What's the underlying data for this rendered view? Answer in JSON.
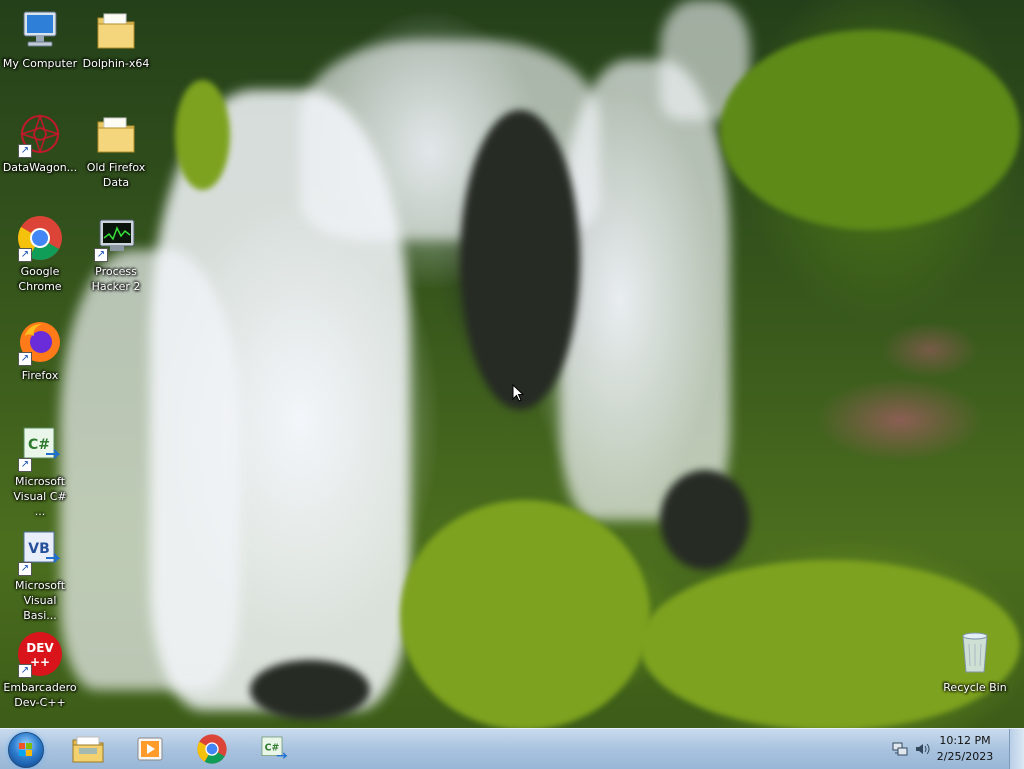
{
  "desktop": {
    "icons": [
      {
        "label": "My Computer",
        "icon": "computer-icon"
      },
      {
        "label": "Dolphin-x64",
        "icon": "folder-icon"
      },
      {
        "label": "DataWagon...",
        "icon": "datawagon-icon"
      },
      {
        "label": "Old Firefox Data",
        "icon": "folder-icon"
      },
      {
        "label": "Google Chrome",
        "icon": "chrome-icon"
      },
      {
        "label": "Process Hacker 2",
        "icon": "process-hacker-icon"
      },
      {
        "label": "Firefox",
        "icon": "firefox-icon"
      },
      {
        "label": "Microsoft Visual C# ...",
        "icon": "visual-csharp-icon",
        "glyph_text": "C#"
      },
      {
        "label": "Microsoft Visual Basi...",
        "icon": "visual-basic-icon",
        "glyph_text": "VB"
      },
      {
        "label": "Embarcadero Dev-C++",
        "icon": "devcpp-icon",
        "glyph_text": "DEV\n++"
      },
      {
        "label": "Recycle Bin",
        "icon": "recycle-bin-icon"
      }
    ]
  },
  "taskbar": {
    "start": {
      "icon": "windows-start-icon"
    },
    "pinned": [
      {
        "name": "Windows Explorer",
        "icon": "file-explorer-icon"
      },
      {
        "name": "Windows Media Player",
        "icon": "media-player-icon"
      },
      {
        "name": "Google Chrome",
        "icon": "chrome-icon"
      },
      {
        "name": "Microsoft Visual C#",
        "icon": "visual-csharp-icon",
        "glyph_text": "C#"
      }
    ],
    "tray": {
      "network_icon": "network-icon",
      "volume_icon": "volume-icon",
      "time": "10:12 PM",
      "date": "2/25/2023"
    }
  },
  "colors": {
    "taskbar": "#a9c3df",
    "chrome_red": "#db4437",
    "chrome_yellow": "#f4c20d",
    "chrome_green": "#0f9d58",
    "chrome_blue": "#4285f4"
  }
}
